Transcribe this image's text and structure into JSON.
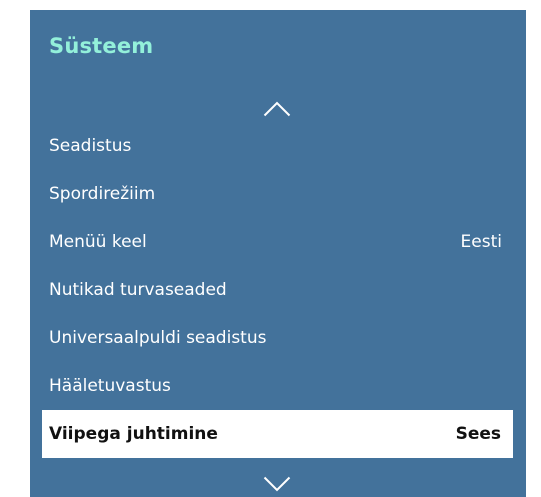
{
  "panel": {
    "title": "Süsteem",
    "background": "#43729b",
    "title_color": "#93f0da",
    "scroll_up_icon": "chevron-up-icon",
    "scroll_down_icon": "chevron-down-icon"
  },
  "menu": {
    "items": [
      {
        "label": "Seadistus",
        "value": ""
      },
      {
        "label": "Spordirežiim",
        "value": ""
      },
      {
        "label": "Menüü keel",
        "value": "Eesti"
      },
      {
        "label": "Nutikad turvaseaded",
        "value": ""
      },
      {
        "label": "Universaalpuldi seadistus",
        "value": ""
      },
      {
        "label": "Hääletuvastus",
        "value": ""
      },
      {
        "label": "Viipega juhtimine",
        "value": "Sees",
        "selected": true
      }
    ]
  }
}
